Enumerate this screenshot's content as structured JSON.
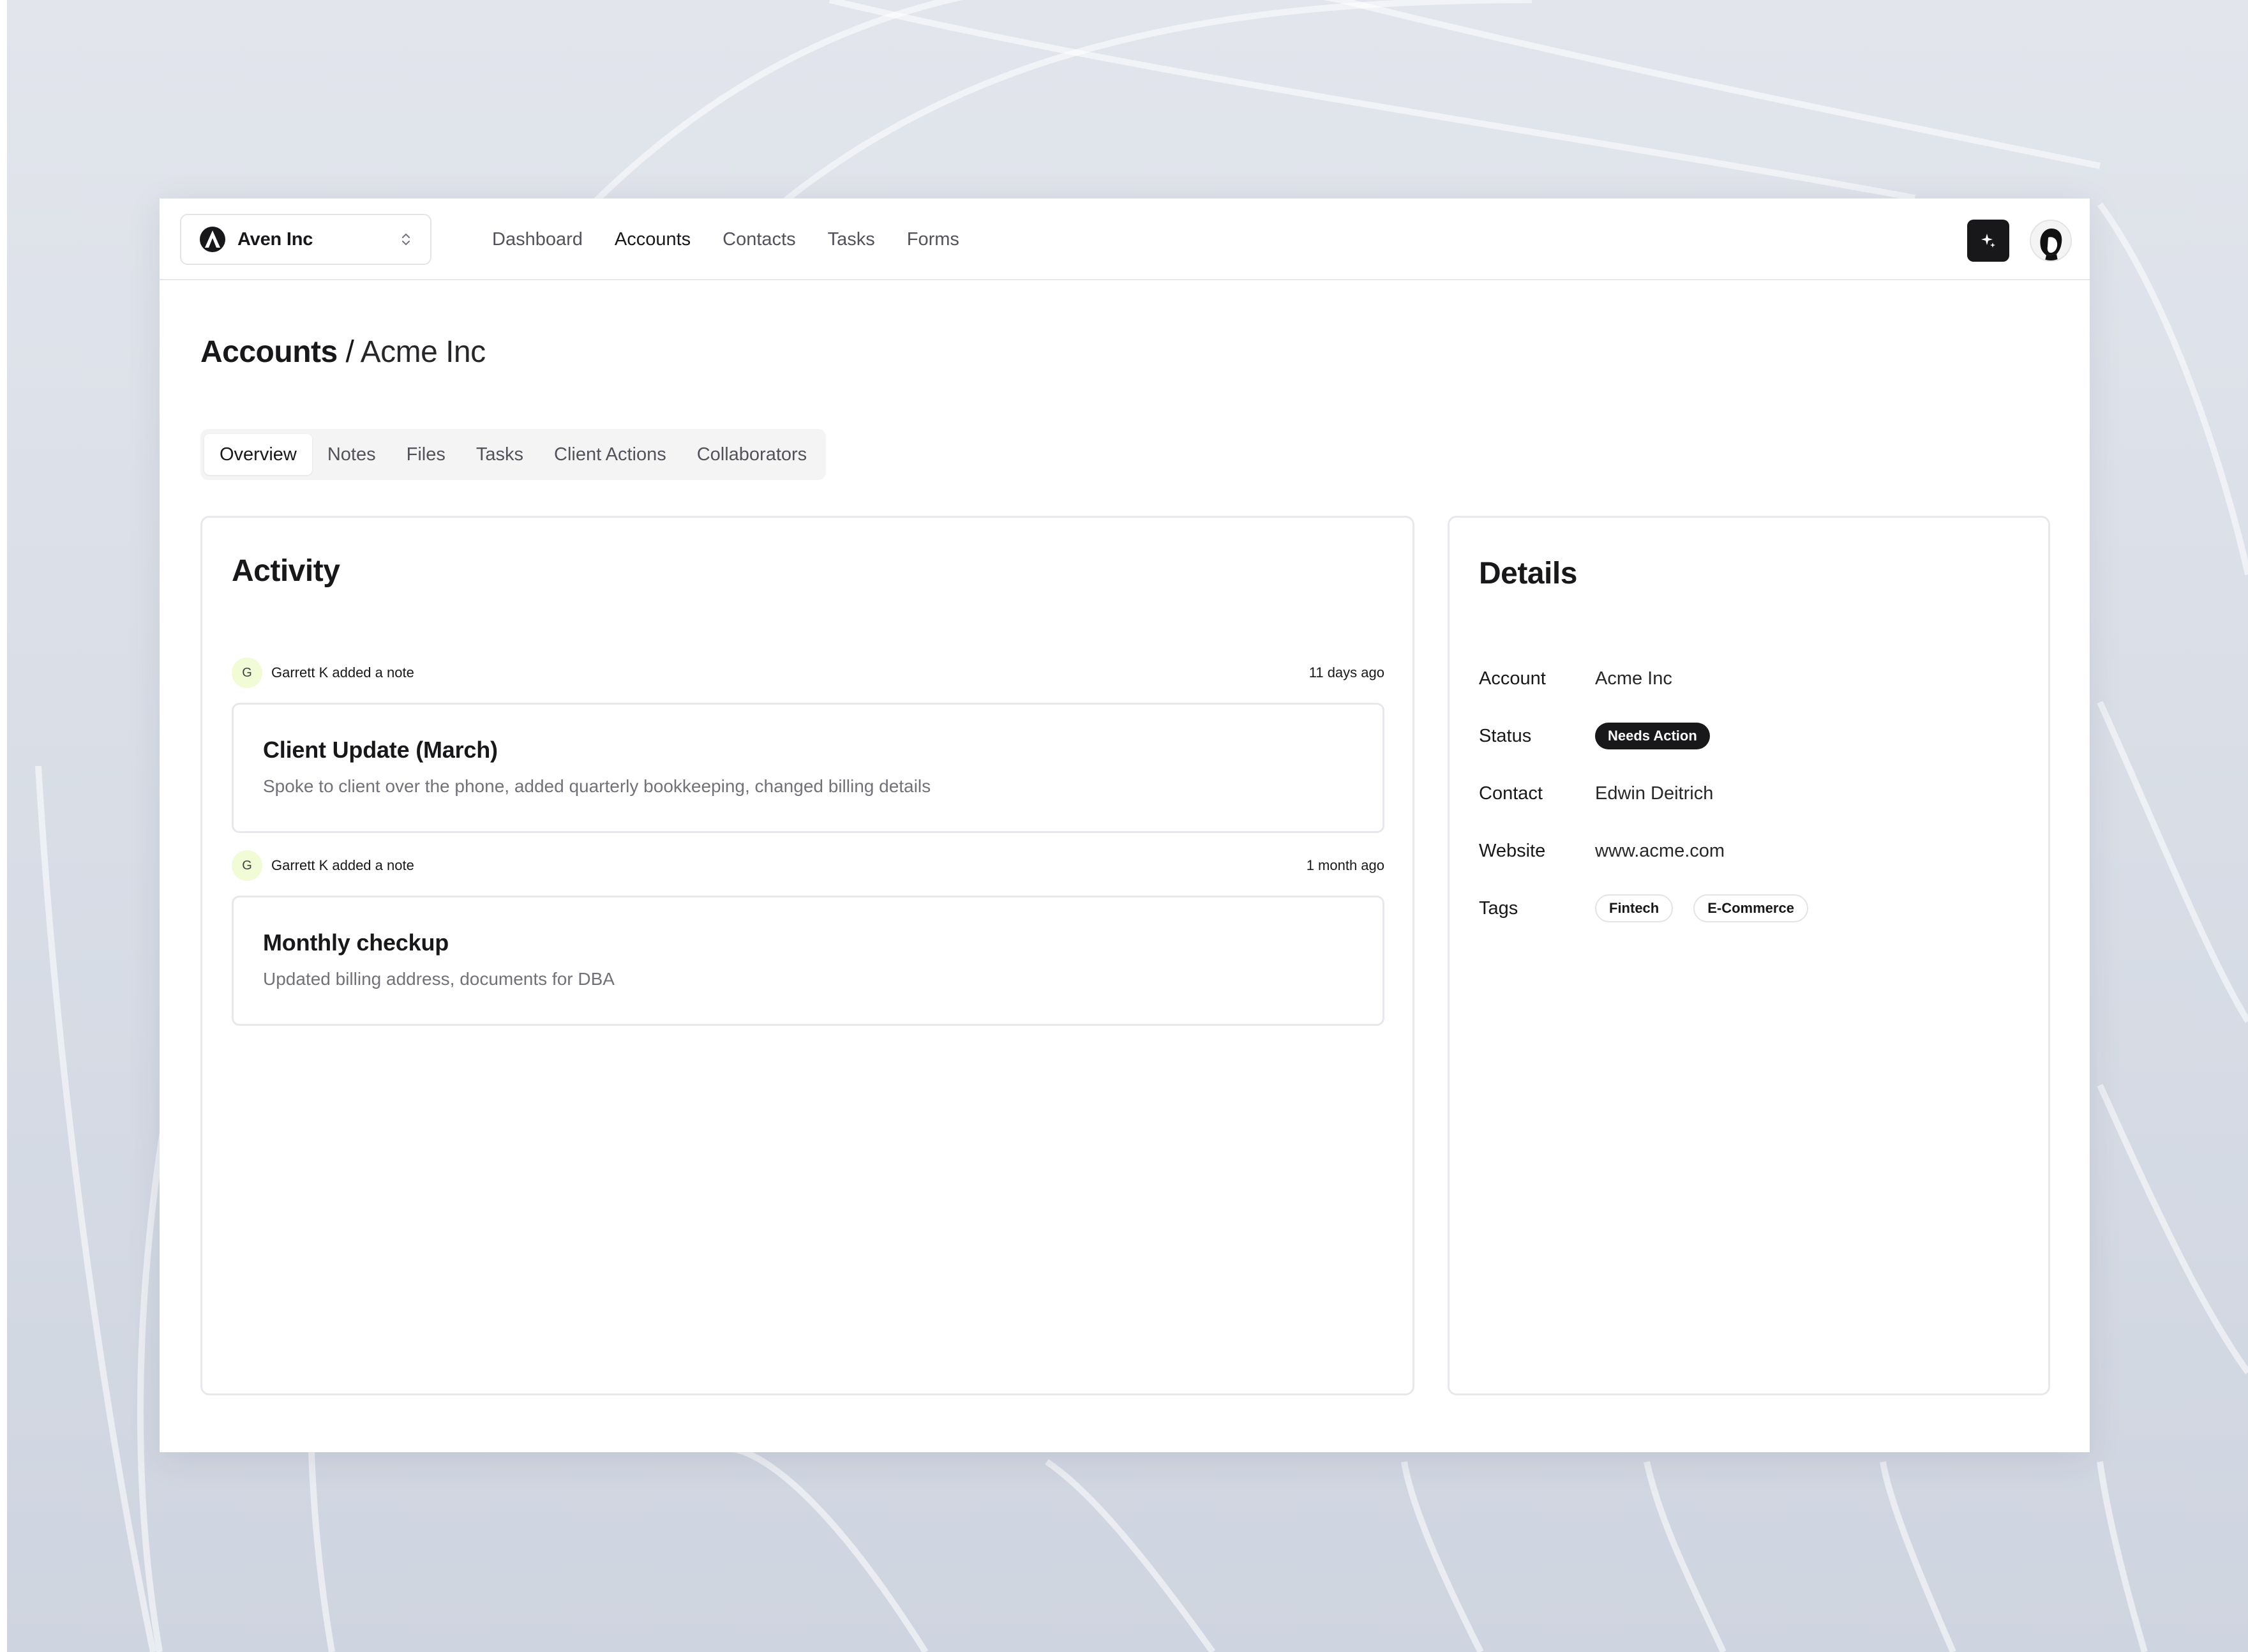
{
  "org": {
    "name": "Aven Inc",
    "logo_icon": "aven-logo-icon",
    "chevron_icon": "chevron-up-down-icon"
  },
  "nav": {
    "items": [
      {
        "label": "Dashboard",
        "active": false
      },
      {
        "label": "Accounts",
        "active": true
      },
      {
        "label": "Contacts",
        "active": false
      },
      {
        "label": "Tasks",
        "active": false
      },
      {
        "label": "Forms",
        "active": false
      }
    ]
  },
  "header_actions": {
    "ai_icon": "sparkles-icon",
    "avatar_icon": "user-avatar"
  },
  "breadcrumb": {
    "root": "Accounts",
    "separator": " / ",
    "current": "Acme Inc"
  },
  "tabs": [
    {
      "label": "Overview",
      "active": true
    },
    {
      "label": "Notes",
      "active": false
    },
    {
      "label": "Files",
      "active": false
    },
    {
      "label": "Tasks",
      "active": false
    },
    {
      "label": "Client Actions",
      "active": false
    },
    {
      "label": "Collaborators",
      "active": false
    }
  ],
  "activity": {
    "title": "Activity",
    "items": [
      {
        "avatar_initial": "G",
        "actor_text": "Garrett K added a note",
        "time": "11 days ago",
        "note_title": "Client Update (March)",
        "note_body": "Spoke to client over the phone, added quarterly bookkeeping, changed billing details"
      },
      {
        "avatar_initial": "G",
        "actor_text": "Garrett K added a note",
        "time": "1 month ago",
        "note_title": "Monthly checkup",
        "note_body": "Updated billing address, documents for DBA"
      }
    ]
  },
  "details": {
    "title": "Details",
    "account": {
      "label": "Account",
      "value": "Acme Inc"
    },
    "status": {
      "label": "Status",
      "value": "Needs Action"
    },
    "contact": {
      "label": "Contact",
      "value": "Edwin Deitrich"
    },
    "website": {
      "label": "Website",
      "value": "www.acme.com"
    },
    "tags": {
      "label": "Tags",
      "values": [
        "Fintech",
        "E-Commerce"
      ]
    }
  },
  "colors": {
    "accent_dark": "#18181b",
    "muted_text": "#71717a",
    "border": "#e7e8ec",
    "avatar_bg": "#f1fbd6",
    "backdrop": "#dce0e8"
  }
}
